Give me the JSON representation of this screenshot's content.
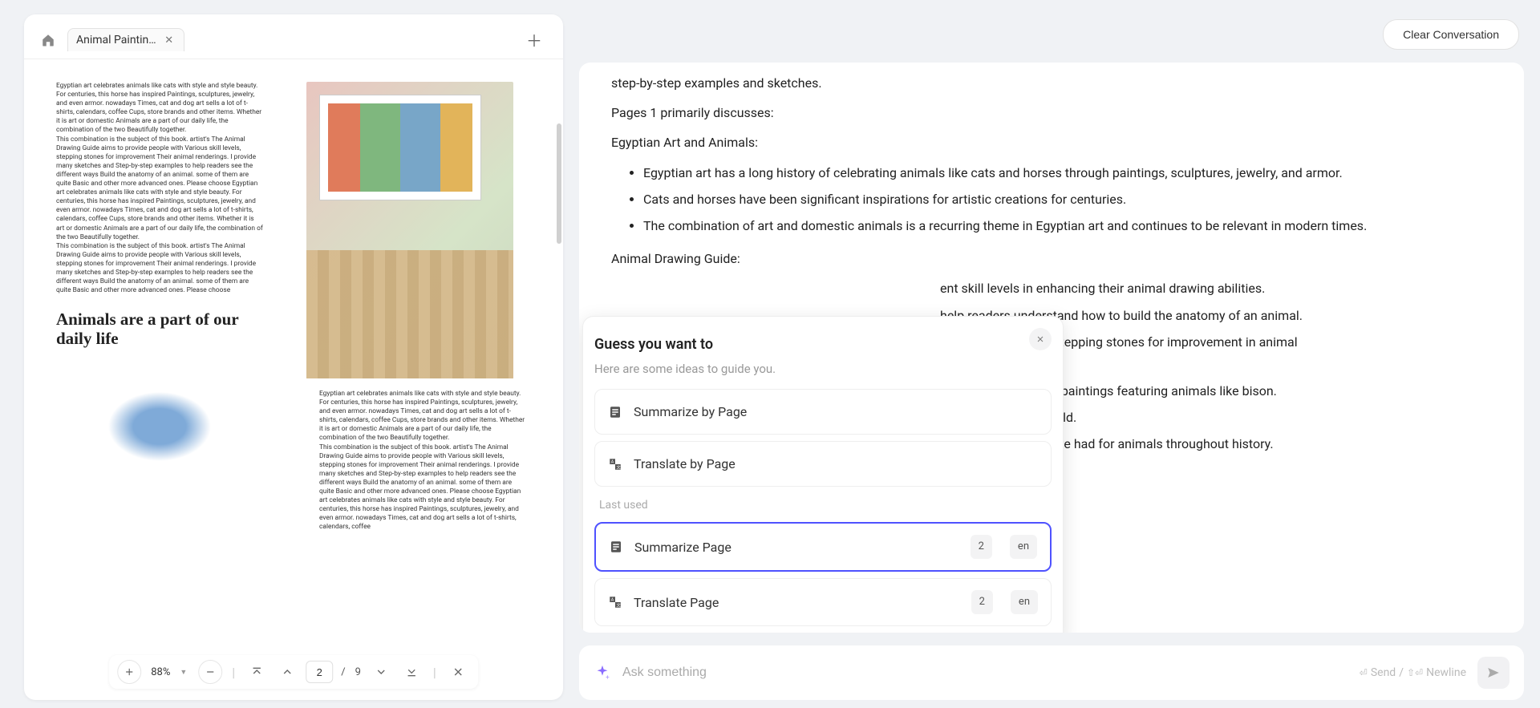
{
  "tab_title": "Animal Paintin…",
  "doc": {
    "col1_para1": "Egyptian art celebrates animals like cats with style and style beauty. For centuries, this horse has inspired Paintings, sculptures, jewelry, and even armor. nowadays Times, cat and dog art sells a lot of t-shirts, calendars, coffee Cups, store brands and other items. Whether it is art or domestic Animals are a part of our daily life, the combination of the two Beautifully together.",
    "col1_para2": "This combination is the subject of this book. artist's The Animal Drawing Guide aims to provide people with Various skill levels, stepping stones for improvement Their animal renderings. I provide many sketches and Step-by-step examples to help readers see the different ways Build the anatomy of an animal. some of them are quite Basic and other more advanced ones. Please choose Egyptian art celebrates animals like cats with style and style beauty. For centuries, this horse has inspired Paintings, sculptures, jewelry, and even armor. nowadays Times, cat and dog art sells a lot of t-shirts, calendars, coffee Cups, store brands and other items. Whether it is art or domestic Animals are a part of our daily life, the combination of the two Beautifully together.",
    "col1_para3": "This combination is the subject of this book. artist's The Animal Drawing Guide aims to provide people with Various skill levels, stepping stones for improvement Their animal renderings. I provide many sketches and Step-by-step examples to help readers see the different ways Build the anatomy of an animal. some of them are quite Basic and other more advanced ones. Please choose",
    "heading": "Animals are a part of our daily life",
    "col2_para1": "Egyptian art celebrates animals like cats with style and style beauty. For centuries, this horse has inspired Paintings, sculptures, jewelry, and even armor. nowadays Times, cat and dog art sells a lot of t-shirts, calendars, coffee Cups, store brands and other items. Whether it is art or domestic Animals are a part of our daily life, the combination of the two Beautifully together.",
    "col2_para2": "This combination is the subject of this book. artist's The Animal Drawing Guide aims to provide people with Various skill levels, stepping stones for improvement Their animal renderings. I provide many sketches and Step-by-step examples to help readers see the different ways Build the anatomy of an animal. some of them are quite Basic and other more advanced ones. Please choose Egyptian art celebrates animals like cats with style and style beauty. For centuries, this horse has inspired Paintings, sculptures, jewelry, and even armor. nowadays Times, cat and dog art sells a lot of t-shirts, calendars, coffee"
  },
  "toolbar": {
    "zoom": "88%",
    "page_current": "2",
    "page_sep": "/",
    "page_total": "9"
  },
  "header": {
    "clear_button": "Clear Conversation"
  },
  "chat": {
    "line0": "step-by-step examples and sketches.",
    "line1": "Pages 1 primarily discusses:",
    "line2": "Egyptian Art and Animals:",
    "bullets_a": [
      "Egyptian art has a long history of celebrating animals like cats and horses through paintings, sculptures, jewelry, and armor.",
      "Cats and horses have been significant inspirations for artistic creations for centuries.",
      "The combination of art and domestic animals is a recurring theme in Egyptian art and continues to be relevant in modern times."
    ],
    "line3": "Animal Drawing Guide:",
    "frag1": "ent skill levels in enhancing their animal drawing abilities.",
    "frag2": "help readers understand how to build the anatomy of an animal.",
    "frag3": "chniques, providing stepping stones for improvement in animal",
    "frag5": "imes, with early cave paintings featuring animals like bison.",
    "frag6": "n with the natural world.",
    "frag7": "everence humans have had for animals throughout history."
  },
  "popover": {
    "title": "Guess you want to",
    "subtitle": "Here are some ideas to guide you.",
    "item1": "Summarize by Page",
    "item2": "Translate by Page",
    "section_label": "Last used",
    "item3": "Summarize Page",
    "item3_badge1": "2",
    "item3_badge2": "en",
    "item4": "Translate Page",
    "item4_badge1": "2",
    "item4_badge2": "en"
  },
  "input": {
    "placeholder": "Ask something",
    "hint_send": "Send",
    "hint_sep": "/",
    "hint_newline": "Newline"
  }
}
